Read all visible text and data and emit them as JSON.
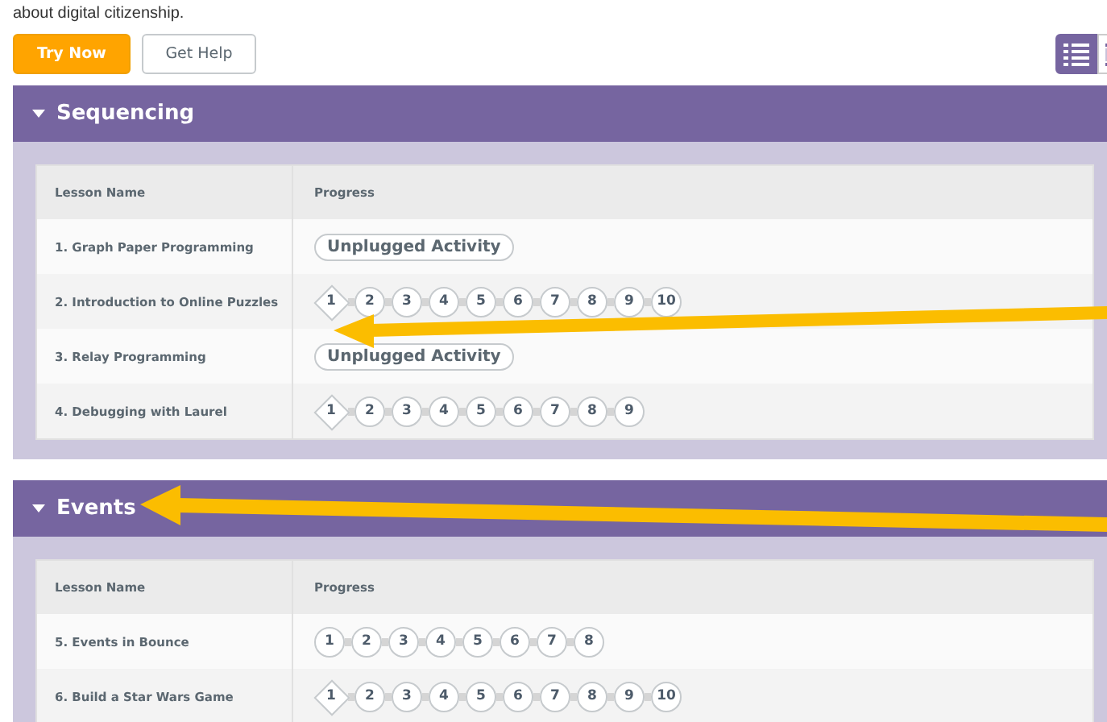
{
  "intro_text": "about digital citizenship.",
  "buttons": [
    {
      "label": "Try Now",
      "kind": "primary"
    },
    {
      "label": "Get Help",
      "kind": "secondary"
    }
  ],
  "view_toggle": [
    {
      "kind": "detail",
      "selected": true
    },
    {
      "kind": "summary",
      "selected": false
    }
  ],
  "sections": [
    {
      "title": "Sequencing",
      "expanded": true,
      "columns": [
        "Lesson Name",
        "Progress"
      ],
      "lessons": [
        {
          "name": "1. Graph Paper Programming",
          "kind": "unplugged",
          "label": "Unplugged Activity"
        },
        {
          "name": "2. Introduction to Online Puzzles",
          "kind": "levels",
          "levels": [
            {
              "label": "1",
              "kind": "diamond"
            },
            {
              "label": "2",
              "kind": "circle"
            },
            {
              "label": "3",
              "kind": "circle"
            },
            {
              "label": "4",
              "kind": "circle"
            },
            {
              "label": "5",
              "kind": "circle"
            },
            {
              "label": "6",
              "kind": "circle"
            },
            {
              "label": "7",
              "kind": "circle"
            },
            {
              "label": "8",
              "kind": "circle"
            },
            {
              "label": "9",
              "kind": "circle"
            },
            {
              "label": "10",
              "kind": "circle"
            }
          ]
        },
        {
          "name": "3. Relay Programming",
          "kind": "unplugged",
          "label": "Unplugged Activity"
        },
        {
          "name": "4. Debugging with Laurel",
          "kind": "levels",
          "levels": [
            {
              "label": "1",
              "kind": "diamond"
            },
            {
              "label": "2",
              "kind": "circle"
            },
            {
              "label": "3",
              "kind": "circle"
            },
            {
              "label": "4",
              "kind": "circle"
            },
            {
              "label": "5",
              "kind": "circle"
            },
            {
              "label": "6",
              "kind": "circle"
            },
            {
              "label": "7",
              "kind": "circle"
            },
            {
              "label": "8",
              "kind": "circle"
            },
            {
              "label": "9",
              "kind": "circle"
            }
          ]
        }
      ]
    },
    {
      "title": "Events",
      "expanded": true,
      "columns": [
        "Lesson Name",
        "Progress"
      ],
      "lessons": [
        {
          "name": "5. Events in Bounce",
          "kind": "levels",
          "levels": [
            {
              "label": "1",
              "kind": "circle"
            },
            {
              "label": "2",
              "kind": "circle"
            },
            {
              "label": "3",
              "kind": "circle"
            },
            {
              "label": "4",
              "kind": "circle"
            },
            {
              "label": "5",
              "kind": "circle"
            },
            {
              "label": "6",
              "kind": "circle"
            },
            {
              "label": "7",
              "kind": "circle"
            },
            {
              "label": "8",
              "kind": "circle"
            }
          ]
        },
        {
          "name": "6. Build a Star Wars Game",
          "kind": "levels",
          "levels": [
            {
              "label": "1",
              "kind": "diamond"
            },
            {
              "label": "2",
              "kind": "circle"
            },
            {
              "label": "3",
              "kind": "circle"
            },
            {
              "label": "4",
              "kind": "circle"
            },
            {
              "label": "5",
              "kind": "circle"
            },
            {
              "label": "6",
              "kind": "circle"
            },
            {
              "label": "7",
              "kind": "circle"
            },
            {
              "label": "8",
              "kind": "circle"
            },
            {
              "label": "9",
              "kind": "circle"
            },
            {
              "label": "10",
              "kind": "circle"
            }
          ]
        }
      ]
    }
  ]
}
